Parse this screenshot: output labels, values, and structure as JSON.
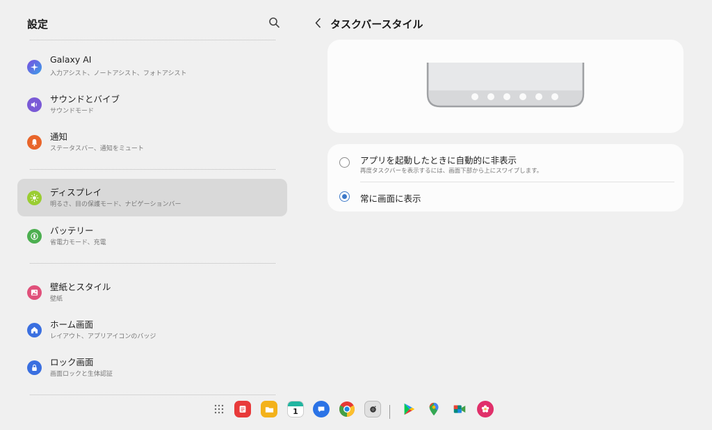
{
  "sidebar": {
    "title": "設定",
    "items": [
      {
        "title": "Galaxy AI",
        "subtitle": "入力アシスト、ノートアシスト、フォトアシスト",
        "icon": "galaxy-ai-icon",
        "color": "#4a7de0"
      },
      {
        "title": "サウンドとバイブ",
        "subtitle": "サウンドモード",
        "icon": "speaker-icon",
        "color": "#7a5ad6"
      },
      {
        "title": "通知",
        "subtitle": "ステータスバー、通知をミュート",
        "icon": "bell-icon",
        "color": "#e8652a"
      },
      {
        "title": "ディスプレイ",
        "subtitle": "明るさ、目の保護モード、ナビゲーションバー",
        "icon": "sun-icon",
        "color": "#9acd32"
      },
      {
        "title": "バッテリー",
        "subtitle": "省電力モード、充電",
        "icon": "battery-icon",
        "color": "#4caf50"
      },
      {
        "title": "壁紙とスタイル",
        "subtitle": "壁紙",
        "icon": "image-icon",
        "color": "#e0507a"
      },
      {
        "title": "ホーム画面",
        "subtitle": "レイアウト、アプリアイコンのバッジ",
        "icon": "home-icon",
        "color": "#3a6fe0"
      },
      {
        "title": "ロック画面",
        "subtitle": "画面ロックと生体認証",
        "icon": "lock-icon",
        "color": "#3a6fe0"
      }
    ],
    "selected_index": 3
  },
  "page": {
    "title": "タスクバースタイル"
  },
  "options": [
    {
      "title": "アプリを起動したときに自動的に非表示",
      "subtitle": "再度タスクバーを表示するには、画面下部から上にスワイプします。",
      "checked": false
    },
    {
      "title": "常に画面に表示",
      "checked": true
    }
  ],
  "taskbar": {
    "apps": [
      "app-drawer-icon",
      "notes-icon",
      "my-files-icon",
      "calendar-icon",
      "messages-icon",
      "chrome-icon",
      "camera-icon",
      "play-store-icon",
      "maps-icon",
      "meet-icon",
      "gallery-icon"
    ],
    "calendar_day": "1"
  },
  "colors": {
    "accent": "#3c78c8",
    "selected_bg": "#d9d9d9",
    "background": "#f0f0f0"
  }
}
